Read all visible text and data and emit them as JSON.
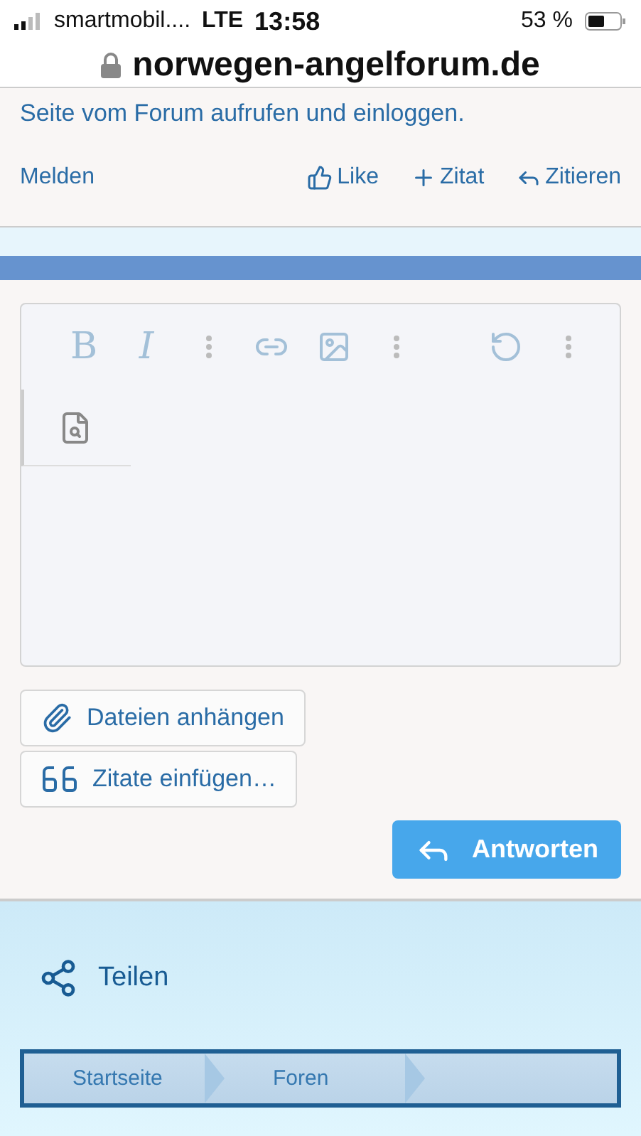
{
  "status_bar": {
    "carrier": "smartmobil....",
    "network": "LTE",
    "time": "13:58",
    "battery": "53 %"
  },
  "address_bar": {
    "url": "norwegen-angelforum.de"
  },
  "post": {
    "text": "Seite vom Forum aufrufen und einloggen.",
    "report": "Melden",
    "actions": [
      {
        "kind": "like",
        "label": "Like"
      },
      {
        "kind": "add",
        "label": "Zitat"
      },
      {
        "kind": "reply",
        "label": "Zitieren"
      }
    ]
  },
  "editor": {
    "tools": [
      {
        "kind": "bold",
        "label": "B"
      },
      {
        "kind": "italic",
        "label": "I"
      },
      {
        "kind": "more"
      },
      {
        "kind": "link"
      },
      {
        "kind": "image"
      },
      {
        "kind": "more"
      },
      {
        "kind": "spacer"
      },
      {
        "kind": "undo"
      },
      {
        "kind": "more"
      }
    ],
    "preview_tab": {
      "selected": false
    }
  },
  "buttons": [
    {
      "kind": "attach",
      "label": "Dateien anhängen"
    },
    {
      "kind": "quote",
      "label": "Zitate einfügen…"
    }
  ],
  "submit": {
    "label": "Antworten"
  },
  "share": {
    "label": "Teilen"
  },
  "breadcrumbs": [
    {
      "label": "Startseite"
    },
    {
      "label": "Foren"
    }
  ]
}
